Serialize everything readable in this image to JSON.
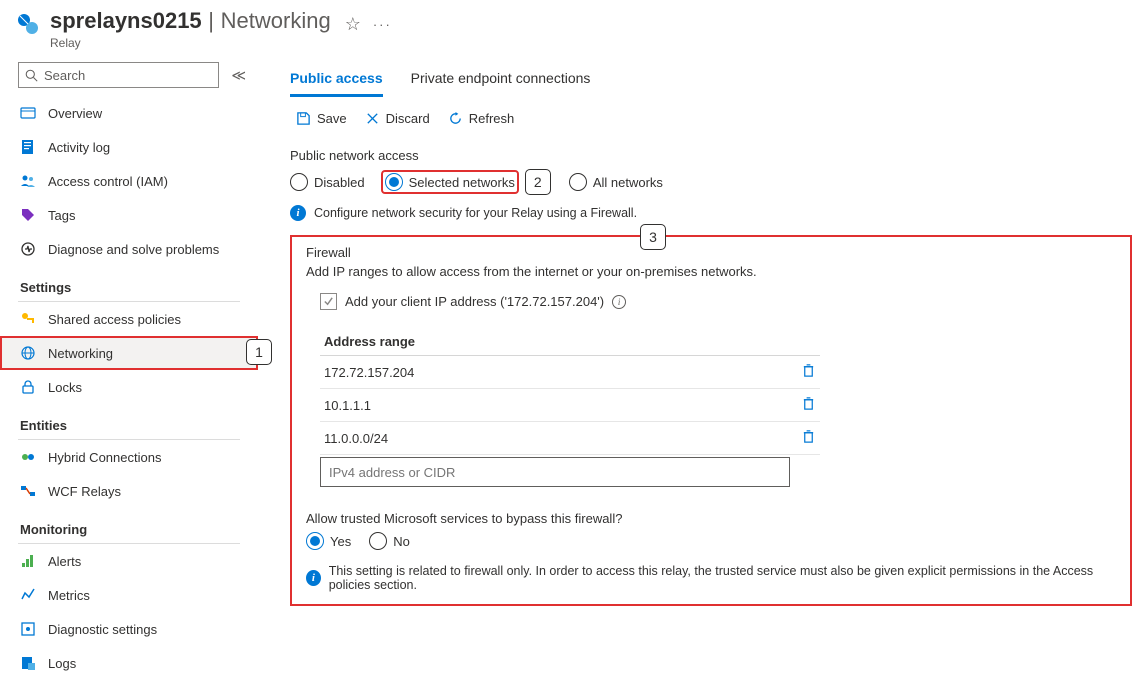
{
  "header": {
    "title": "sprelayns0215",
    "subtitle": "Networking",
    "breadcrumb": "Relay"
  },
  "search": {
    "placeholder": "Search"
  },
  "nav": {
    "items": [
      {
        "label": "Overview"
      },
      {
        "label": "Activity log"
      },
      {
        "label": "Access control (IAM)"
      },
      {
        "label": "Tags"
      },
      {
        "label": "Diagnose and solve problems"
      }
    ],
    "settings_title": "Settings",
    "settings": [
      {
        "label": "Shared access policies"
      },
      {
        "label": "Networking"
      },
      {
        "label": "Locks"
      }
    ],
    "entities_title": "Entities",
    "entities": [
      {
        "label": "Hybrid Connections"
      },
      {
        "label": "WCF Relays"
      }
    ],
    "monitoring_title": "Monitoring",
    "monitoring": [
      {
        "label": "Alerts"
      },
      {
        "label": "Metrics"
      },
      {
        "label": "Diagnostic settings"
      },
      {
        "label": "Logs"
      }
    ]
  },
  "tabs": {
    "public": "Public access",
    "private": "Private endpoint connections"
  },
  "toolbar": {
    "save": "Save",
    "discard": "Discard",
    "refresh": "Refresh"
  },
  "access": {
    "label": "Public network access",
    "disabled": "Disabled",
    "selected": "Selected networks",
    "all": "All networks",
    "info": "Configure network security for your Relay using a Firewall."
  },
  "callouts": {
    "one": "1",
    "two": "2",
    "three": "3"
  },
  "firewall": {
    "title": "Firewall",
    "desc": "Add IP ranges to allow access from the internet or your on-premises networks.",
    "add_client": "Add your client IP address ('172.72.157.204')",
    "col_header": "Address range",
    "rows": [
      "172.72.157.204",
      "10.1.1.1",
      "11.0.0.0/24"
    ],
    "placeholder": "IPv4 address or CIDR",
    "allow_label": "Allow trusted Microsoft services to bypass this firewall?",
    "yes": "Yes",
    "no": "No",
    "note": "This setting is related to firewall only. In order to access this relay, the trusted service must also be given explicit permissions in the Access policies section."
  }
}
